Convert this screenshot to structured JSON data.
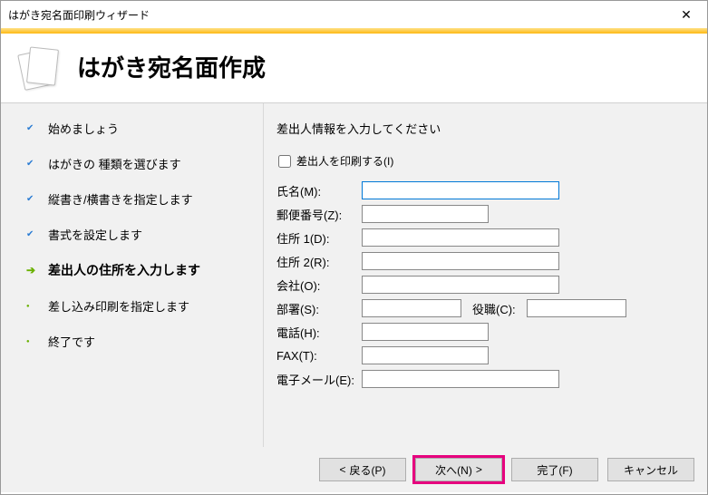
{
  "window": {
    "title": "はがき宛名面印刷ウィザード"
  },
  "header": {
    "title": "はがき宛名面作成"
  },
  "sidebar": {
    "steps": [
      {
        "label": "始めましょう",
        "state": "done"
      },
      {
        "label": "はがきの 種類を選びます",
        "state": "done"
      },
      {
        "label": "縦書き/横書きを指定します",
        "state": "done"
      },
      {
        "label": "書式を設定します",
        "state": "done"
      },
      {
        "label": "差出人の住所を入力します",
        "state": "current"
      },
      {
        "label": "差し込み印刷を指定します",
        "state": "pending"
      },
      {
        "label": "終了です",
        "state": "pending"
      }
    ]
  },
  "form": {
    "title": "差出人情報を入力してください",
    "print_sender_label": "差出人を印刷する(I)",
    "print_sender_checked": false,
    "fields": {
      "name": {
        "label": "氏名(M):",
        "value": ""
      },
      "zip": {
        "label": "郵便番号(Z):",
        "value": ""
      },
      "addr1": {
        "label": "住所 1(D):",
        "value": ""
      },
      "addr2": {
        "label": "住所 2(R):",
        "value": ""
      },
      "company": {
        "label": "会社(O):",
        "value": ""
      },
      "dept": {
        "label": "部署(S):",
        "value": ""
      },
      "role": {
        "label": "役職(C):",
        "value": ""
      },
      "tel": {
        "label": "電話(H):",
        "value": ""
      },
      "fax": {
        "label": "FAX(T):",
        "value": ""
      },
      "email": {
        "label": "電子メール(E):",
        "value": ""
      }
    }
  },
  "buttons": {
    "back": "戻る(P)",
    "next": "次へ(N)",
    "finish": "完了(F)",
    "cancel": "キャンセル"
  }
}
